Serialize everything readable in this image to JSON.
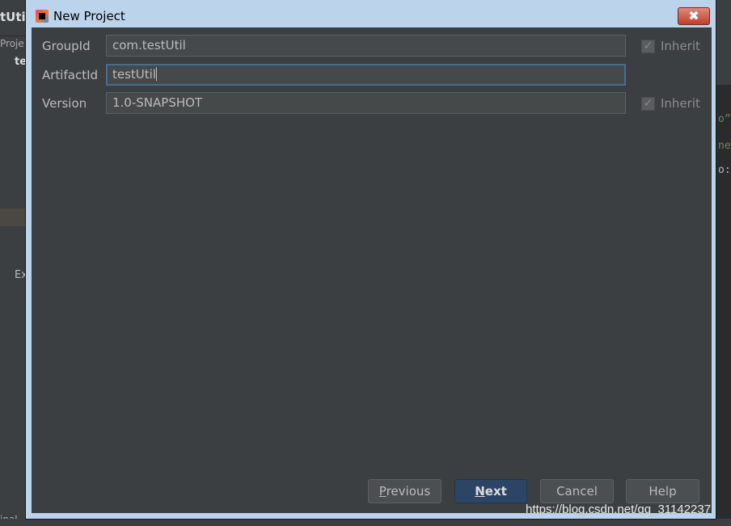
{
  "background_ide": {
    "title_fragment": "tUtil",
    "panel_fragment": "Proje",
    "tree_fragment": "te",
    "ext_fragment": "Ex",
    "bottom_fragment": "inal",
    "code_fragments": [
      "o”",
      "ner",
      "o:"
    ]
  },
  "dialog": {
    "title": "New Project",
    "close_label": "✖",
    "fields": [
      {
        "label": "GroupId",
        "value": "com.testUtil",
        "inherit": true,
        "inherit_label": "Inherit"
      },
      {
        "label": "ArtifactId",
        "value": "testUtil",
        "focused": true
      },
      {
        "label": "Version",
        "value": "1.0-SNAPSHOT",
        "inherit": true,
        "inherit_label": "Inherit"
      }
    ],
    "buttons": {
      "previous": {
        "mnemonic": "P",
        "rest": "revious"
      },
      "next": {
        "mnemonic": "N",
        "rest": "ext"
      },
      "cancel": "Cancel",
      "help": "Help"
    }
  },
  "watermark": "https://blog.csdn.net/qq_31142237",
  "colors": {
    "dialog_bg": "#3c3f41",
    "primary_button": "#2c4566",
    "frame": "#bcd3ec"
  }
}
